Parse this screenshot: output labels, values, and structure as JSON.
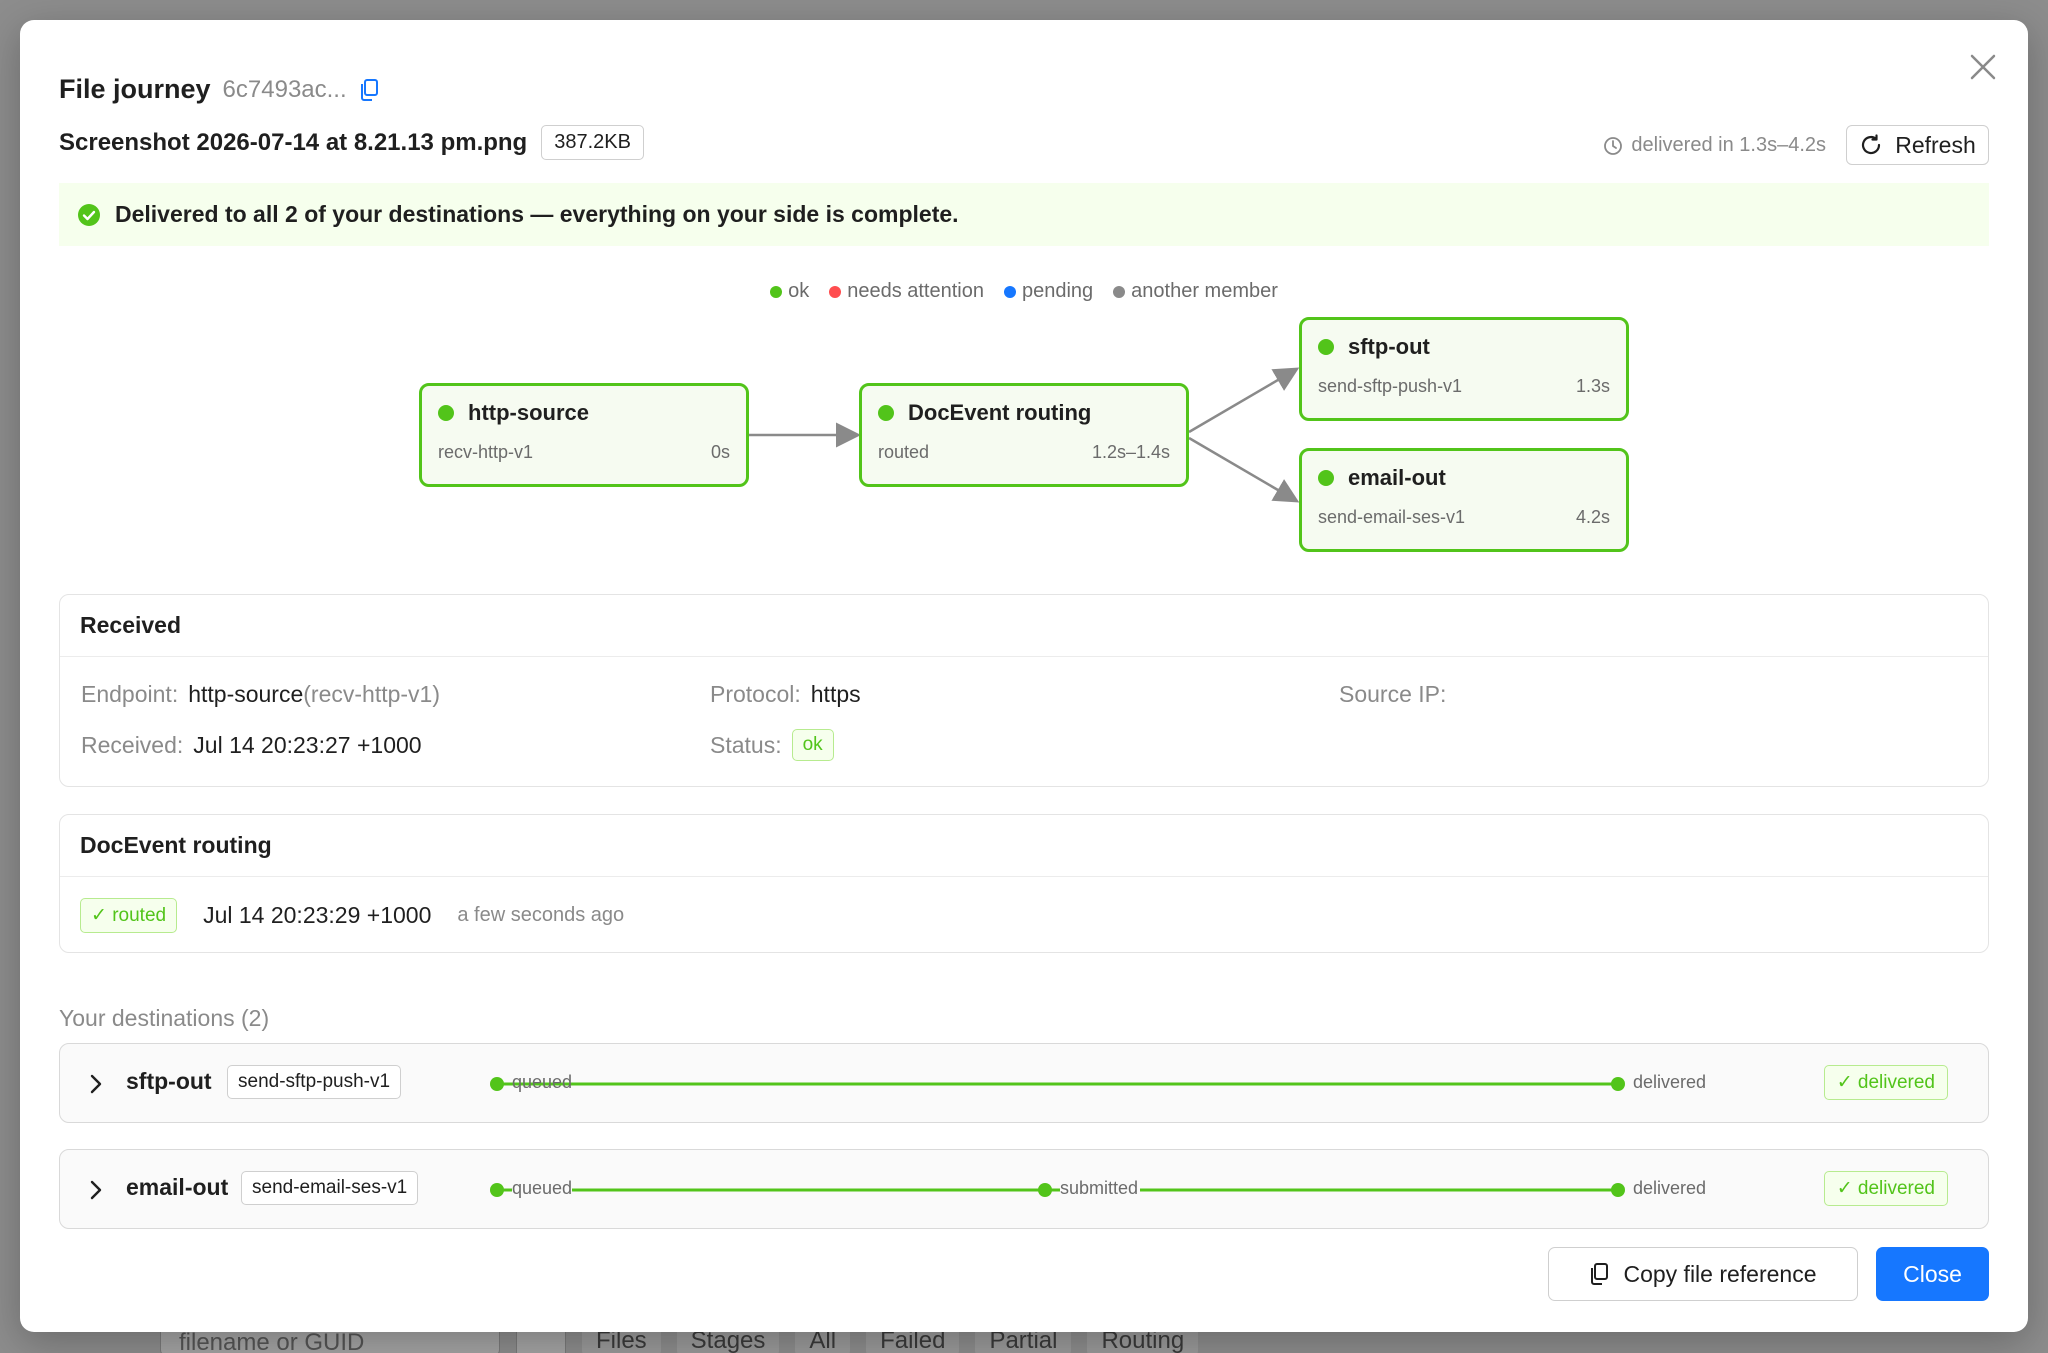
{
  "backdrop": {
    "search_placeholder": "filename or GUID",
    "view_tabs": [
      "Files",
      "Stages"
    ],
    "filter_tabs": [
      "All",
      "Failed",
      "Partial",
      "Routing"
    ]
  },
  "modal": {
    "title": "File journey",
    "guid": "6c7493ac...",
    "file_name": "Screenshot 2026-07-14 at 8.21.13 pm.png",
    "file_size": "387.2KB",
    "timing": "delivered in 1.3s–4.2s",
    "refresh_label": "Refresh"
  },
  "banner": {
    "text": "Delivered to all 2 of your destinations — everything on your side is complete.",
    "color": "#52c41a"
  },
  "legend": [
    {
      "label": "ok",
      "color": "#52c41a"
    },
    {
      "label": "needs attention",
      "color": "#ff4d4f"
    },
    {
      "label": "pending",
      "color": "#1677ff"
    },
    {
      "label": "another member",
      "color": "#8a8a8a"
    }
  ],
  "flow": {
    "nodes": [
      {
        "title": "http-source",
        "sub": "recv-http-v1",
        "time": "0s"
      },
      {
        "title": "DocEvent routing",
        "sub": "routed",
        "time": "1.2s–1.4s"
      },
      {
        "title": "sftp-out",
        "sub": "send-sftp-push-v1",
        "time": "1.3s"
      },
      {
        "title": "email-out",
        "sub": "send-email-ses-v1",
        "time": "4.2s"
      }
    ]
  },
  "received": {
    "title": "Received",
    "endpoint_label": "Endpoint",
    "endpoint_value": "http-source",
    "endpoint_sub": "(recv-http-v1)",
    "protocol_label": "Protocol",
    "protocol_value": "https",
    "source_ip_label": "Source IP",
    "received_label": "Received",
    "received_value": "Jul 14 20:23:27 +1000",
    "status_label": "Status",
    "status_value": "ok"
  },
  "routing": {
    "title": "DocEvent routing",
    "tag": "✓ routed",
    "time": "Jul 14 20:23:29 +1000",
    "relative": "a few seconds ago"
  },
  "destinations": {
    "heading": "Your destinations (2)",
    "items": [
      {
        "name": "sftp-out",
        "pill": "send-sftp-push-v1",
        "steps": [
          "queued",
          "delivered"
        ],
        "status": "✓ delivered"
      },
      {
        "name": "email-out",
        "pill": "send-email-ses-v1",
        "steps": [
          "queued",
          "submitted",
          "delivered"
        ],
        "status": "✓ delivered"
      }
    ]
  },
  "footer": {
    "copy_label": "Copy file reference",
    "close_label": "Close"
  },
  "colors": {
    "accent": "#1677ff",
    "ok": "#52c41a"
  }
}
